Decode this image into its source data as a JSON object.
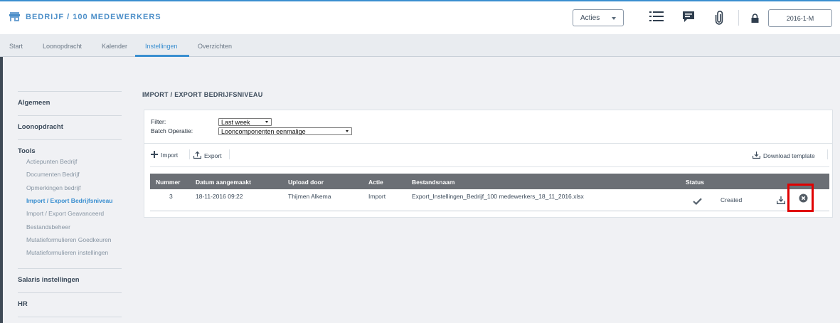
{
  "header": {
    "brand": "BEDRIJF / 100 MEDEWERKERS",
    "acties_label": "Acties",
    "period": "2016-1-M",
    "icons": [
      "store-icon",
      "list-icon",
      "comment-icon",
      "paperclip-icon",
      "lock-icon"
    ]
  },
  "tabs": [
    {
      "label": "Start"
    },
    {
      "label": "Loonopdracht"
    },
    {
      "label": "Kalender"
    },
    {
      "label": "Instellingen",
      "active": true
    },
    {
      "label": "Overzichten"
    }
  ],
  "sidebar": {
    "groups": [
      {
        "label": "Algemeen"
      },
      {
        "label": "Loonopdracht"
      },
      {
        "label": "Tools",
        "items": [
          {
            "label": "Actiepunten Bedrijf"
          },
          {
            "label": "Documenten Bedrijf"
          },
          {
            "label": "Opmerkingen bedrijf"
          },
          {
            "label": "Import / Export Bedrijfsniveau",
            "active": true
          },
          {
            "label": "Import / Export Geavanceerd"
          },
          {
            "label": "Bestandsbeheer"
          },
          {
            "label": "Mutatieformulieren Goedkeuren"
          },
          {
            "label": "Mutatieformulieren instellingen"
          }
        ]
      },
      {
        "label": "Salaris instellingen"
      },
      {
        "label": "HR"
      }
    ]
  },
  "main": {
    "title": "IMPORT / EXPORT BEDRIJFSNIVEAU",
    "filter_label": "Filter:",
    "filter_value": "Last week",
    "batch_label": "Batch Operatie:",
    "batch_value": "Looncomponenten eenmalige",
    "toolbar": {
      "import_label": "Import",
      "export_label": "Export",
      "download_template_label": "Download template"
    },
    "table": {
      "columns": [
        "Nummer",
        "Datum aangemaakt",
        "Upload door",
        "Actie",
        "Bestandsnaam",
        "Status"
      ],
      "rows": [
        {
          "nummer": "3",
          "datum": "18-11-2016 09:22",
          "upload_door": "Thijmen Alkema",
          "actie": "Import",
          "bestandsnaam": "Export_Instellingen_Bedrijf_100 medewerkers_18_11_2016.xlsx",
          "status_text": "Created"
        }
      ]
    }
  },
  "colors": {
    "accent": "#3a8fd0",
    "table_header": "#6b6f75",
    "highlight": "#e00000"
  }
}
